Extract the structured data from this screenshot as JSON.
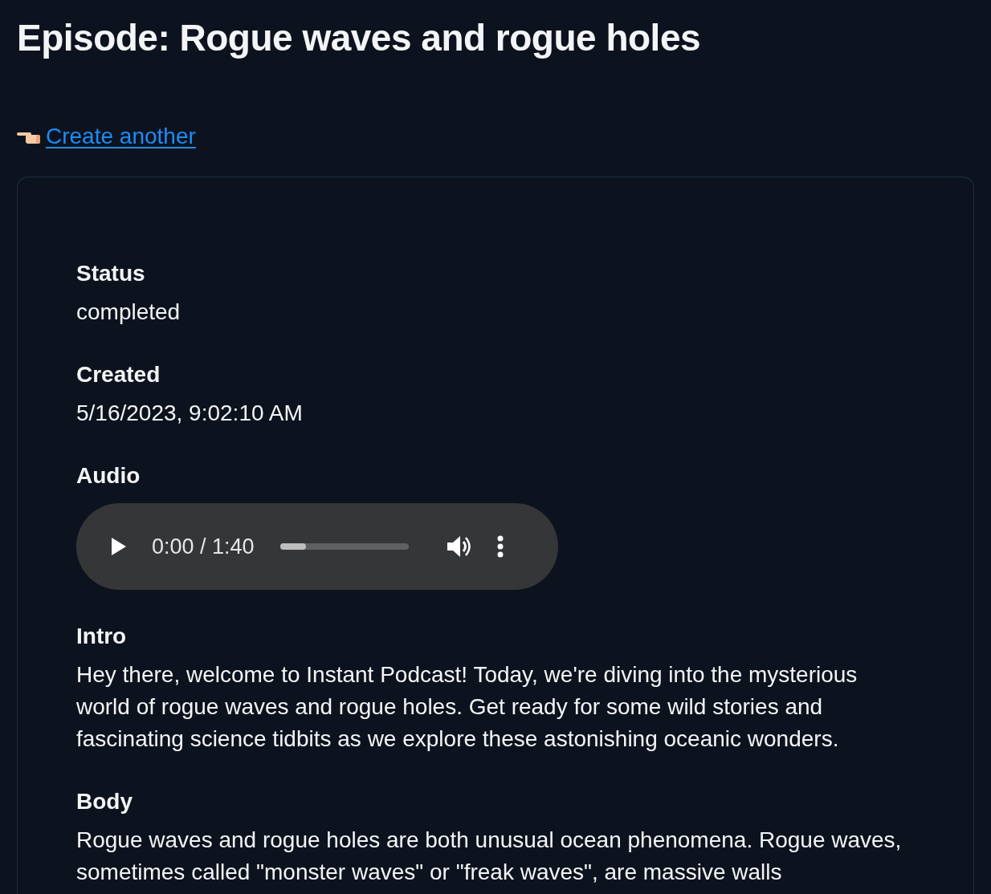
{
  "title": "Episode: Rogue waves and rogue holes",
  "link": {
    "label": "Create another"
  },
  "fields": [
    {
      "kind": "text",
      "label": "Status",
      "value": "completed"
    },
    {
      "kind": "text",
      "label": "Created",
      "value": "5/16/2023, 9:02:10 AM"
    },
    {
      "kind": "audio",
      "label": "Audio",
      "time": "0:00 / 1:40",
      "level": 0.2
    },
    {
      "kind": "text",
      "label": "Intro",
      "value": "Hey there, welcome to Instant Podcast! Today, we're diving into the mysterious world of rogue waves and rogue holes. Get ready for some wild stories and fascinating science tidbits as we explore these astonishing oceanic wonders."
    },
    {
      "kind": "text",
      "label": "Body",
      "value": "Rogue waves and rogue holes are both unusual ocean phenomena. Rogue waves, sometimes called \"monster waves\" or \"freak waves\", are massive walls"
    }
  ]
}
